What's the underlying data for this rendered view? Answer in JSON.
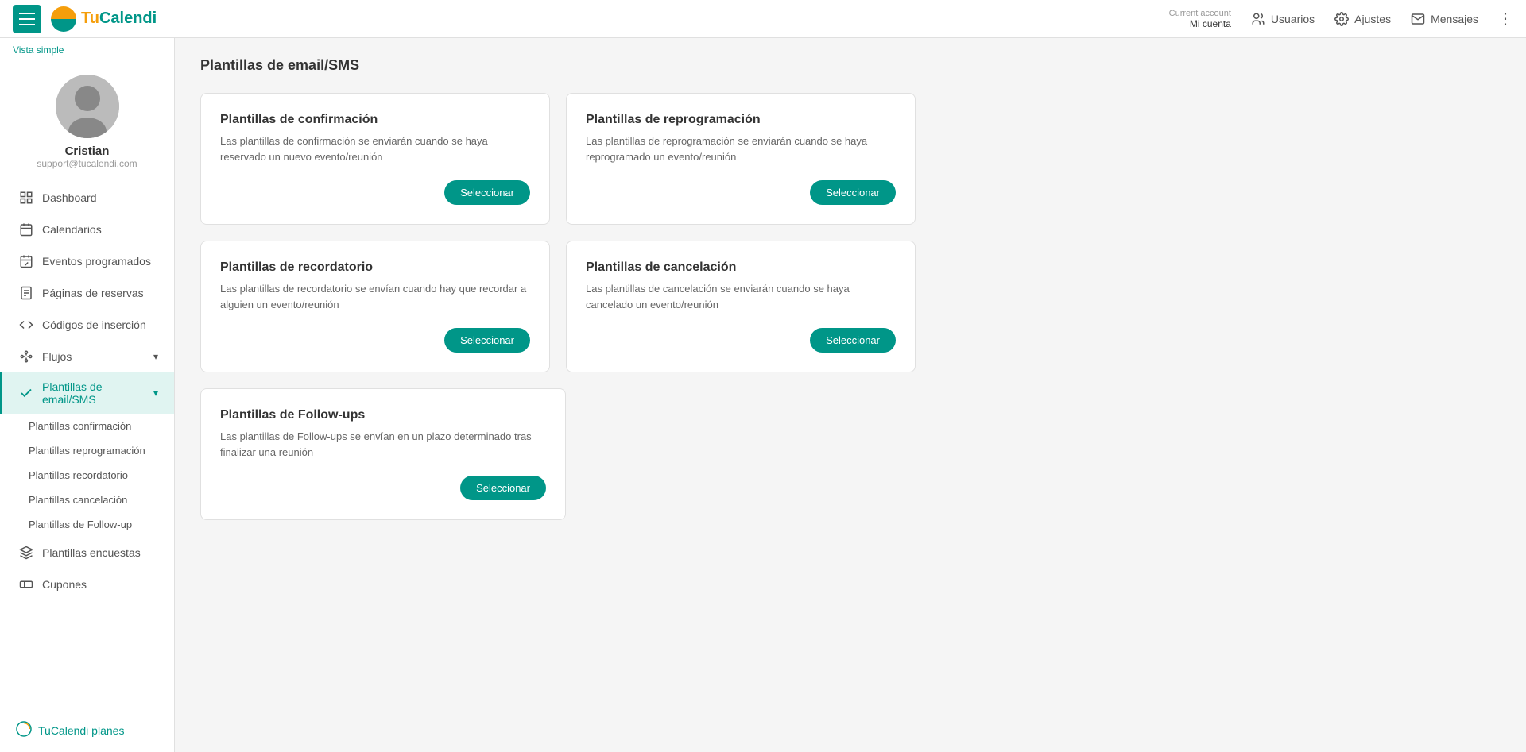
{
  "topnav": {
    "hamburger_label": "Menu",
    "logo_text": "TuCalendi",
    "account_label": "Current account",
    "account_name": "Mi cuenta",
    "nav_items": [
      {
        "id": "usuarios",
        "label": "Usuarios",
        "icon": "users-icon"
      },
      {
        "id": "ajustes",
        "label": "Ajustes",
        "icon": "gear-icon"
      },
      {
        "id": "mensajes",
        "label": "Mensajes",
        "icon": "mail-icon"
      }
    ],
    "more_label": "⋮"
  },
  "sidebar": {
    "vista_simple": "Vista simple",
    "profile": {
      "name": "Cristian",
      "email": "support@tucalendi.com"
    },
    "nav_items": [
      {
        "id": "dashboard",
        "label": "Dashboard",
        "icon": "dashboard-icon"
      },
      {
        "id": "calendarios",
        "label": "Calendarios",
        "icon": "calendar-icon"
      },
      {
        "id": "eventos",
        "label": "Eventos programados",
        "icon": "check-calendar-icon"
      },
      {
        "id": "paginas",
        "label": "Páginas de reservas",
        "icon": "page-icon"
      },
      {
        "id": "codigos",
        "label": "Códigos de inserción",
        "icon": "code-icon"
      },
      {
        "id": "flujos",
        "label": "Flujos",
        "icon": "flow-icon",
        "has_chevron": true
      },
      {
        "id": "plantillas",
        "label": "Plantillas de email/SMS",
        "icon": "check-icon",
        "active": true,
        "has_chevron": true
      }
    ],
    "subnav_items": [
      {
        "id": "confirmacion",
        "label": "Plantillas confirmación"
      },
      {
        "id": "reprogramacion",
        "label": "Plantillas reprogramación"
      },
      {
        "id": "recordatorio",
        "label": "Plantillas recordatorio"
      },
      {
        "id": "cancelacion",
        "label": "Plantillas cancelación"
      },
      {
        "id": "followup",
        "label": "Plantillas de Follow-up"
      }
    ],
    "bottom_nav": [
      {
        "id": "encuestas",
        "label": "Plantillas encuestas",
        "icon": "layers-icon"
      },
      {
        "id": "cupones",
        "label": "Cupones",
        "icon": "coupon-icon"
      }
    ],
    "plans_label": "TuCalendi planes",
    "plans_icon": "logo-icon"
  },
  "main": {
    "page_title": "Plantillas de email/SMS",
    "cards": [
      {
        "id": "confirmacion",
        "title": "Plantillas de confirmación",
        "description": "Las plantillas de confirmación se enviarán cuando se haya reservado un nuevo evento/reunión",
        "button_label": "Seleccionar"
      },
      {
        "id": "reprogramacion",
        "title": "Plantillas de reprogramación",
        "description": "Las plantillas de reprogramación se enviarán cuando se haya reprogramado un evento/reunión",
        "button_label": "Seleccionar"
      },
      {
        "id": "recordatorio",
        "title": "Plantillas de recordatorio",
        "description": "Las plantillas de recordatorio se envían cuando hay que recordar a alguien un evento/reunión",
        "button_label": "Seleccionar"
      },
      {
        "id": "cancelacion",
        "title": "Plantillas de cancelación",
        "description": "Las plantillas de cancelación se enviarán cuando se haya cancelado un evento/reunión",
        "button_label": "Seleccionar"
      }
    ],
    "card_followup": {
      "id": "followup",
      "title": "Plantillas de Follow-ups",
      "description": "Las plantillas de Follow-ups se envían en un plazo determinado tras finalizar una reunión",
      "button_label": "Seleccionar"
    }
  }
}
